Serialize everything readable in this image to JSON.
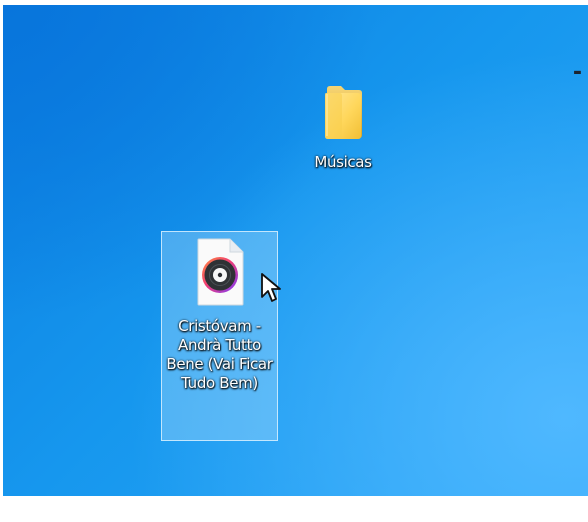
{
  "desktop": {
    "background_color": "#1697ee",
    "top_right_mark": "-",
    "icons": [
      {
        "label": "Músicas",
        "type": "folder",
        "icon": "folder-icon",
        "selected": false
      },
      {
        "label": "Cristóvam - Andrà Tutto Bene (Vai Ficar Tudo Bem)",
        "type": "audio-file",
        "icon": "music-file-icon",
        "selected": true
      }
    ]
  },
  "cursor": {
    "icon": "mouse-pointer-icon"
  }
}
